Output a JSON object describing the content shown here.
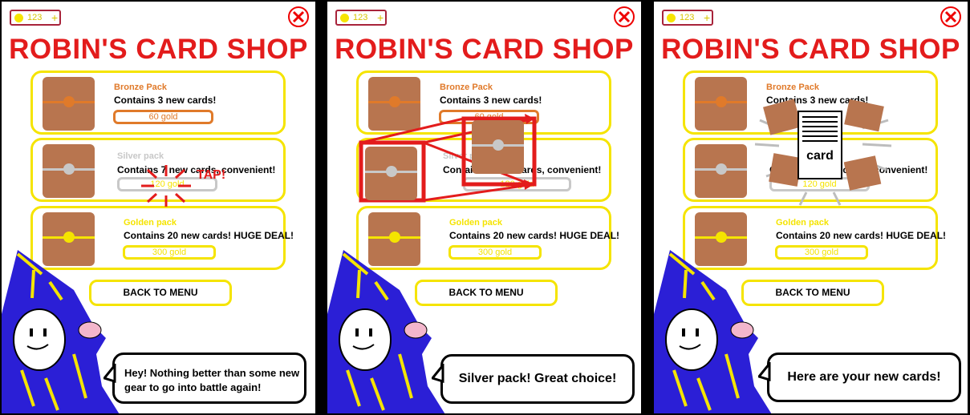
{
  "hud": {
    "coins": "123",
    "plus": "+"
  },
  "shop_title": "ROBIN'S CARD SHOP",
  "packs": [
    {
      "name": "Bronze Pack",
      "desc": "Contains 3 new cards!",
      "price": "60 gold",
      "color": "#e07a2a"
    },
    {
      "name": "Silver pack",
      "desc": "Contains 7 new cards, convenient!",
      "price": "120 gold",
      "color": "#c8c8c8"
    },
    {
      "name": "Golden pack",
      "desc": "Contains 20 new cards! HUGE DEAL!",
      "price": "300 gold",
      "color": "#f5e400"
    }
  ],
  "back_button": "BACK TO MENU",
  "tap_label": "TAP!",
  "card_label": "card",
  "dialogue": [
    "Hey! Nothing better than some new gear to go into battle again!",
    "Silver pack! Great choice!",
    "Here are your new cards!"
  ],
  "colors": {
    "title": "#e31c1c",
    "chest": "#b8754f",
    "panel_border": "#000000"
  }
}
